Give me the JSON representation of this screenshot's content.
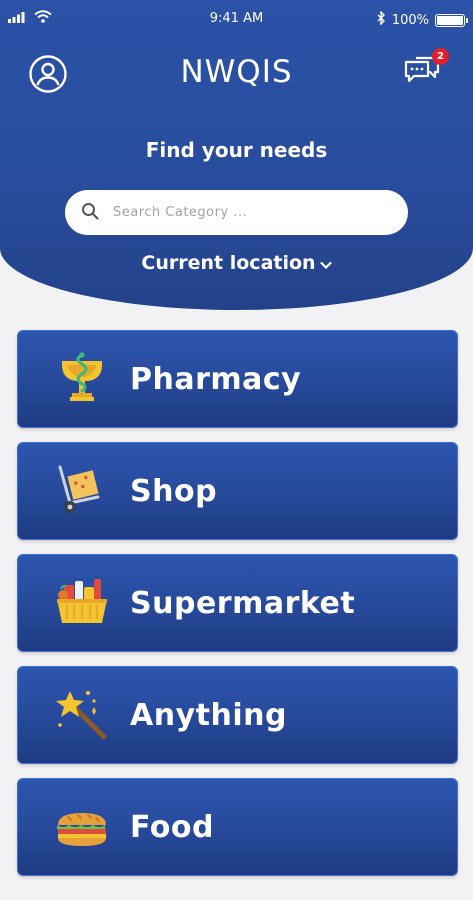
{
  "status_bar": {
    "time": "9:41 AM",
    "battery": "100%"
  },
  "app": {
    "title": "NWQIS",
    "notifications_count": "2"
  },
  "hero": {
    "heading": "Find your needs",
    "search_placeholder": "Search Category ...",
    "location_label": "Current location"
  },
  "categories": [
    {
      "label": "Pharmacy",
      "icon": "pharmacy-icon"
    },
    {
      "label": "Shop",
      "icon": "hand-truck-icon"
    },
    {
      "label": "Supermarket",
      "icon": "basket-icon"
    },
    {
      "label": "Anything",
      "icon": "magic-wand-icon"
    },
    {
      "label": "Food",
      "icon": "sandwich-icon"
    }
  ],
  "colors": {
    "primary": "#2a4fa3",
    "badge": "#e5202c",
    "background": "#f2f2f4"
  }
}
